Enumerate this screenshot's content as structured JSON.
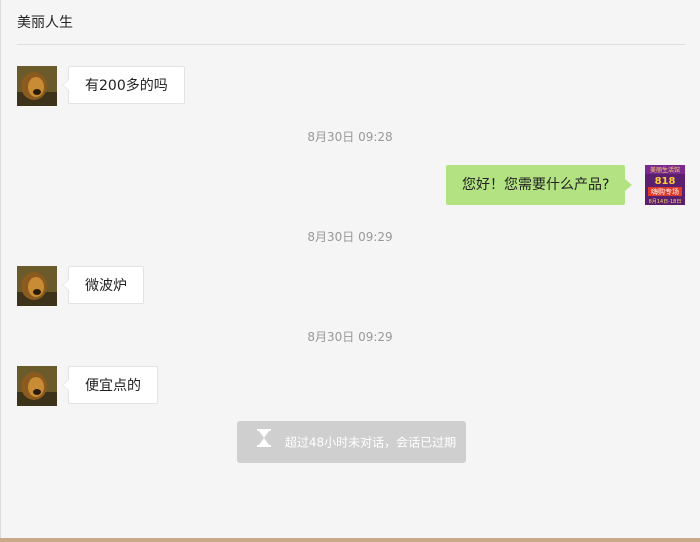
{
  "header": {
    "title": "美丽人生"
  },
  "messages": [
    {
      "side": "left",
      "text": "有200多的吗"
    },
    {
      "timestamp": "8月30日 09:28"
    },
    {
      "side": "right",
      "text": "您好！您需要什么产品?"
    },
    {
      "timestamp": "8月30日 09:29"
    },
    {
      "side": "left",
      "text": "微波炉"
    },
    {
      "timestamp": "8月30日 09:29"
    },
    {
      "side": "left",
      "text": "便宜点的"
    }
  ],
  "notice": {
    "text": "超过48小时未对话，会话已过期",
    "icon": "hourglass-icon"
  },
  "avatars": {
    "customer": "lion-avatar",
    "merchant": {
      "brand_lines": [
        "美丽生活馆",
        "818",
        "嗨购专场",
        "8月14日-18日"
      ]
    }
  },
  "colors": {
    "sent_bubble": "#b2e281",
    "received_bubble": "#ffffff",
    "notice_bg": "#cfcfcf"
  }
}
